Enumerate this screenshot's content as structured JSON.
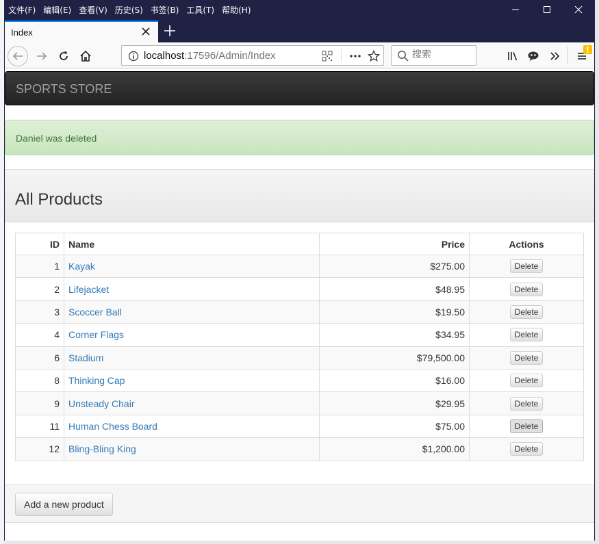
{
  "menu": [
    "文件(F)",
    "编辑(E)",
    "查看(V)",
    "历史(S)",
    "书签(B)",
    "工具(T)",
    "帮助(H)"
  ],
  "tab": {
    "title": "Index"
  },
  "urlbar": {
    "host": "localhost",
    "path": ":17596/Admin/Index"
  },
  "search": {
    "placeholder": "搜索"
  },
  "brand": "SPORTS STORE",
  "alert": "Daniel was deleted",
  "heading": "All Products",
  "table": {
    "headers": {
      "id": "ID",
      "name": "Name",
      "price": "Price",
      "actions": "Actions"
    },
    "rows": [
      {
        "id": "1",
        "name": "Kayak",
        "price": "$275.00",
        "action": "Delete"
      },
      {
        "id": "2",
        "name": "Lifejacket",
        "price": "$48.95",
        "action": "Delete"
      },
      {
        "id": "3",
        "name": "Scoccer Ball",
        "price": "$19.50",
        "action": "Delete"
      },
      {
        "id": "4",
        "name": "Corner Flags",
        "price": "$34.95",
        "action": "Delete"
      },
      {
        "id": "6",
        "name": "Stadium",
        "price": "$79,500.00",
        "action": "Delete"
      },
      {
        "id": "8",
        "name": "Thinking Cap",
        "price": "$16.00",
        "action": "Delete"
      },
      {
        "id": "9",
        "name": "Unsteady Chair",
        "price": "$29.95",
        "action": "Delete"
      },
      {
        "id": "11",
        "name": "Human Chess Board",
        "price": "$75.00",
        "action": "Delete"
      },
      {
        "id": "12",
        "name": "Bling-Bling King",
        "price": "$1,200.00",
        "action": "Delete"
      }
    ]
  },
  "footer": {
    "add_label": "Add a new product"
  },
  "colors": {
    "titlebar": "#1f2245",
    "accent": "#0a84ff",
    "link": "#337ab7",
    "alert_text": "#3c763d",
    "warning_badge": "#ffbf00"
  }
}
